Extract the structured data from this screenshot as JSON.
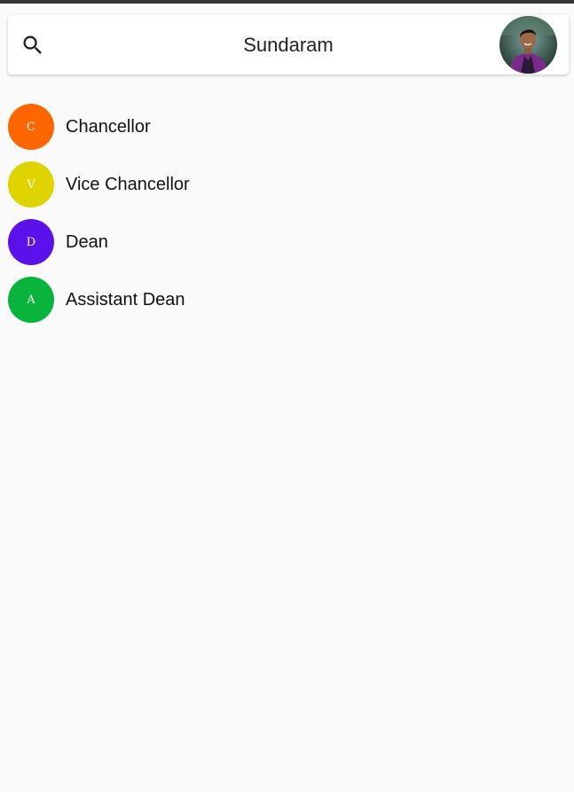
{
  "app": {
    "search_title": "Sundaram",
    "search_icon": "search-icon",
    "avatar_icon": "profile-avatar"
  },
  "list": {
    "items": [
      {
        "initial": "C",
        "label": "Chancellor",
        "color": "#ff6600"
      },
      {
        "initial": "V",
        "label": "Vice Chancellor",
        "color": "#e0d400"
      },
      {
        "initial": "D",
        "label": "Dean",
        "color": "#5b12ea"
      },
      {
        "initial": "A",
        "label": "Assistant Dean",
        "color": "#09b43c"
      }
    ]
  },
  "colors": {
    "background": "#fafafa",
    "status_strip": "#333333",
    "search_bar": "#ffffff"
  }
}
